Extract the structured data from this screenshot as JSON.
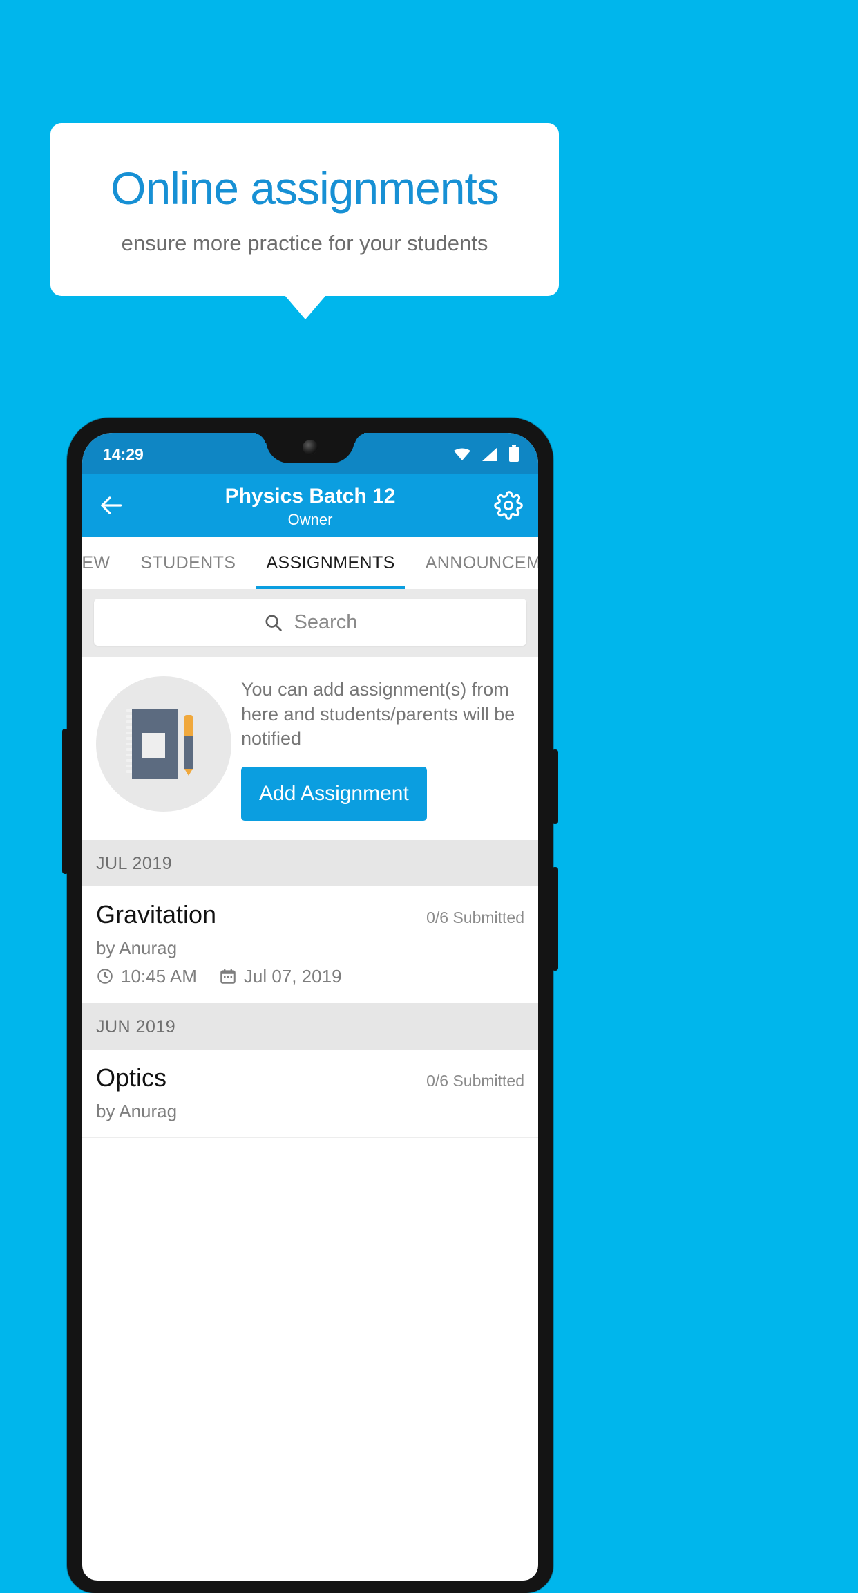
{
  "promo": {
    "title": "Online assignments",
    "subtitle": "ensure more practice for your students",
    "background_color": "#00b6ec",
    "title_color": "#1790d4"
  },
  "phone": {
    "statusbar": {
      "time": "14:29",
      "icons": [
        "wifi-icon",
        "signal-icon",
        "battery-icon"
      ],
      "background_color": "#0f86c4"
    },
    "appbar": {
      "back_icon": "back-arrow-icon",
      "title": "Physics Batch 12",
      "subtitle": "Owner",
      "settings_icon": "gear-icon",
      "background_color": "#0b9ee0"
    },
    "tabs": [
      {
        "label": "IEW",
        "active": false
      },
      {
        "label": "STUDENTS",
        "active": false
      },
      {
        "label": "ASSIGNMENTS",
        "active": true
      },
      {
        "label": "ANNOUNCEM",
        "active": false
      }
    ],
    "search": {
      "placeholder": "Search",
      "value": "",
      "icon": "search-icon"
    },
    "empty_state": {
      "illustration": "notebook-pen-icon",
      "text": "You can add assignment(s) from here and students/parents will be notified",
      "button_label": "Add Assignment"
    },
    "sections": [
      {
        "month": "JUL 2019",
        "assignments": [
          {
            "title": "Gravitation",
            "submitted": "0/6 Submitted",
            "author": "by Anurag",
            "time": "10:45 AM",
            "date": "Jul 07, 2019",
            "time_icon": "clock-icon",
            "date_icon": "calendar-icon"
          }
        ]
      },
      {
        "month": "JUN 2019",
        "assignments": [
          {
            "title": "Optics",
            "submitted": "0/6 Submitted",
            "author": "by Anurag",
            "time": "",
            "date": "",
            "time_icon": "clock-icon",
            "date_icon": "calendar-icon"
          }
        ]
      }
    ]
  }
}
